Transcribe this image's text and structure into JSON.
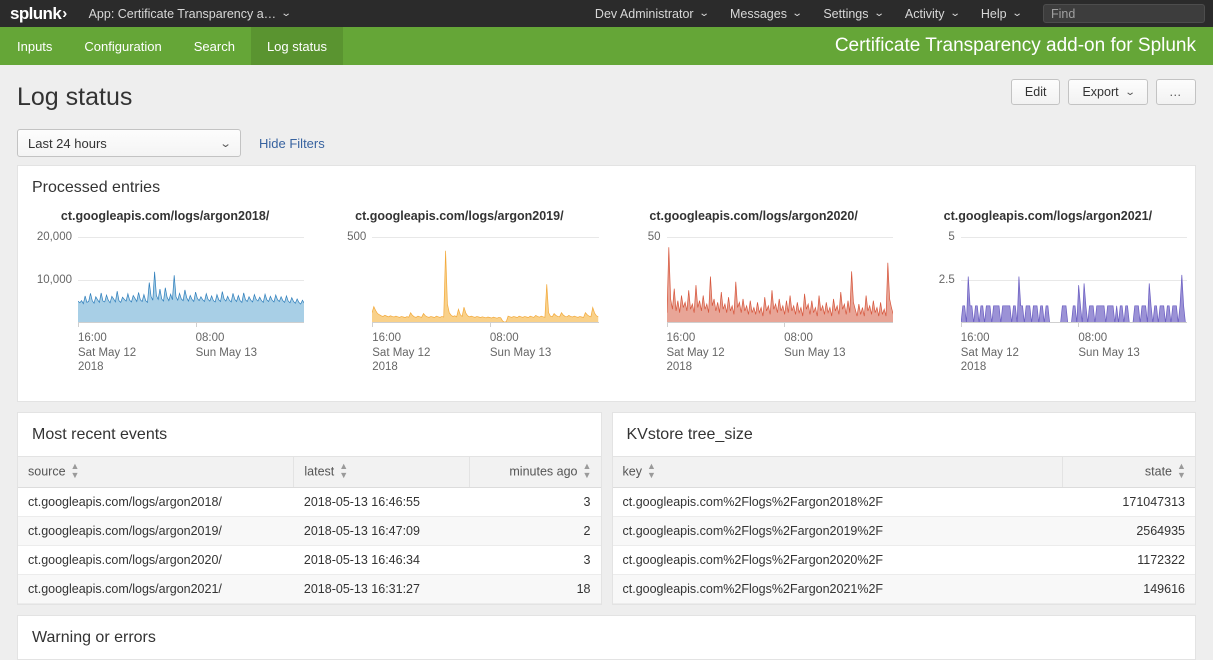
{
  "topbar": {
    "logo": "splunk",
    "logo_chevron": "›",
    "app_menu": "App: Certificate Transparency a…",
    "nav": [
      {
        "label": "Dev Administrator",
        "caret": "⌄"
      },
      {
        "label": "Messages",
        "caret": "⌄"
      },
      {
        "label": "Settings",
        "caret": "⌄"
      },
      {
        "label": "Activity",
        "caret": "⌄"
      },
      {
        "label": "Help",
        "caret": "⌄"
      }
    ],
    "find_placeholder": "Find",
    "find_value": ""
  },
  "appbar": {
    "items": [
      {
        "label": "Inputs",
        "active": false
      },
      {
        "label": "Configuration",
        "active": false
      },
      {
        "label": "Search",
        "active": false
      },
      {
        "label": "Log status",
        "active": true
      }
    ],
    "title": "Certificate Transparency add-on for Splunk"
  },
  "page": {
    "title": "Log status",
    "actions": {
      "edit": "Edit",
      "export": "Export",
      "export_caret": "⌄",
      "more": "…"
    }
  },
  "filters": {
    "time_range": "Last 24 hours",
    "time_caret": "⌄",
    "hide_filters": "Hide Filters"
  },
  "panels": {
    "processed_entries": "Processed entries",
    "most_recent_events": "Most recent events",
    "kvstore_tree_size": "KVstore tree_size",
    "warning_or_errors": "Warning or errors"
  },
  "chart_data": [
    {
      "type": "area",
      "title": "ct.googleapis.com/logs/argon2018/",
      "color": "#2e7ebb",
      "fill": "#a8cfe6",
      "ylim": [
        0,
        20000
      ],
      "yticks": [
        20000,
        10000
      ],
      "ytick_labels": [
        "20,000",
        "10,000"
      ],
      "xlabels": [
        {
          "time": "16:00",
          "date": "Sat May 12",
          "year": "2018",
          "pos": 0.0
        },
        {
          "time": "08:00",
          "date": "Sun May 13",
          "year": "",
          "pos": 0.52
        }
      ],
      "values": [
        5100,
        4700,
        5200,
        4500,
        6300,
        4800,
        5000,
        6900,
        5200,
        4600,
        6100,
        5400,
        4800,
        7000,
        5100,
        4900,
        6500,
        5300,
        4700,
        6200,
        5600,
        4900,
        7400,
        5200,
        4800,
        6000,
        5500,
        5100,
        6800,
        5300,
        4900,
        6400,
        5700,
        5000,
        7100,
        5400,
        5000,
        6600,
        5200,
        4800,
        9400,
        6200,
        5300,
        11900,
        6400,
        5500,
        7900,
        5600,
        5100,
        8200,
        6000,
        5200,
        6700,
        5400,
        11100,
        6100,
        5300,
        6900,
        5600,
        5200,
        7700,
        5900,
        5100,
        6400,
        5500,
        5000,
        7200,
        5700,
        5200,
        6100,
        5400,
        5000,
        6800,
        5500,
        5100,
        6300,
        5200,
        4900,
        6600,
        5400,
        5000,
        7300,
        5600,
        5100,
        6200,
        5300,
        4900,
        6900,
        5500,
        5000,
        6400,
        5200,
        4800,
        7000,
        5400,
        5000,
        6100,
        5300,
        4900,
        6600,
        5500,
        5100,
        6000,
        5200,
        4800,
        6700,
        5400,
        5000,
        6200,
        5300,
        4900,
        6500,
        5400,
        5000,
        6100,
        5200,
        4800,
        6300,
        5100,
        4700,
        5900,
        5000,
        4600,
        5600,
        4800,
        4400,
        5300,
        4600
      ]
    },
    {
      "type": "area",
      "title": "ct.googleapis.com/logs/argon2019/",
      "color": "#f2a93b",
      "fill": "#f9d18a",
      "ylim": [
        0,
        500
      ],
      "yticks": [
        500
      ],
      "ytick_labels": [
        "500"
      ],
      "xlabels": [
        {
          "time": "16:00",
          "date": "Sat May 12",
          "year": "2018",
          "pos": 0.0
        },
        {
          "time": "08:00",
          "date": "Sun May 13",
          "year": "",
          "pos": 0.52
        }
      ],
      "values": [
        60,
        95,
        72,
        55,
        48,
        42,
        38,
        45,
        40,
        36,
        42,
        38,
        35,
        40,
        36,
        33,
        38,
        35,
        32,
        37,
        34,
        60,
        44,
        36,
        33,
        40,
        36,
        33,
        55,
        42,
        36,
        33,
        38,
        35,
        32,
        40,
        36,
        33,
        38,
        35,
        420,
        110,
        60,
        45,
        38,
        42,
        36,
        80,
        48,
        38,
        92,
        58,
        42,
        36,
        40,
        36,
        33,
        38,
        35,
        32,
        36,
        33,
        30,
        35,
        32,
        29,
        34,
        31,
        28,
        33,
        30,
        12,
        5,
        8,
        40,
        36,
        33,
        38,
        35,
        32,
        40,
        36,
        33,
        38,
        35,
        32,
        40,
        36,
        33,
        44,
        38,
        34,
        40,
        36,
        33,
        225,
        60,
        40,
        36,
        55,
        44,
        38,
        36,
        60,
        46,
        38,
        36,
        44,
        38,
        35,
        40,
        36,
        33,
        38,
        35,
        32,
        60,
        48,
        40,
        36,
        90,
        58,
        42,
        36
      ]
    },
    {
      "type": "area",
      "title": "ct.googleapis.com/logs/argon2020/",
      "color": "#d6563c",
      "fill": "#e8a597",
      "ylim": [
        0,
        50
      ],
      "yticks": [
        50
      ],
      "ytick_labels": [
        "50"
      ],
      "xlabels": [
        {
          "time": "16:00",
          "date": "Sat May 12",
          "year": "2018",
          "pos": 0.0
        },
        {
          "time": "08:00",
          "date": "Sun May 13",
          "year": "",
          "pos": 0.52
        }
      ],
      "values": [
        6,
        44,
        14,
        8,
        20,
        7,
        13,
        6,
        16,
        9,
        12,
        7,
        19,
        8,
        11,
        6,
        22,
        9,
        13,
        7,
        16,
        8,
        11,
        6,
        27,
        10,
        14,
        7,
        12,
        6,
        18,
        8,
        11,
        6,
        15,
        7,
        10,
        5,
        24,
        9,
        12,
        6,
        14,
        7,
        10,
        5,
        13,
        6,
        9,
        5,
        12,
        6,
        9,
        4,
        15,
        7,
        10,
        5,
        19,
        8,
        11,
        6,
        14,
        7,
        10,
        5,
        13,
        6,
        16,
        7,
        10,
        5,
        12,
        6,
        9,
        4,
        17,
        8,
        11,
        5,
        13,
        6,
        9,
        4,
        16,
        7,
        10,
        5,
        12,
        6,
        9,
        4,
        14,
        7,
        10,
        5,
        18,
        8,
        11,
        5,
        13,
        6,
        30,
        12,
        8,
        4,
        11,
        5,
        9,
        4,
        16,
        7,
        10,
        5,
        13,
        6,
        9,
        4,
        12,
        5,
        8,
        4,
        35,
        14,
        9,
        5
      ]
    },
    {
      "type": "area",
      "title": "ct.googleapis.com/logs/argon2021/",
      "color": "#6a5dc1",
      "fill": "#9b92d6",
      "ylim": [
        0,
        5
      ],
      "yticks": [
        5,
        2.5
      ],
      "ytick_labels": [
        "5",
        "2.5"
      ],
      "xlabels": [
        {
          "time": "16:00",
          "date": "Sat May 12",
          "year": "2018",
          "pos": 0.0
        },
        {
          "time": "08:00",
          "date": "Sun May 13",
          "year": "",
          "pos": 0.52
        }
      ],
      "values": [
        0,
        1,
        1,
        0,
        2.7,
        1,
        1,
        0,
        1,
        1,
        0,
        1,
        1,
        0,
        1,
        1,
        1,
        0,
        1,
        1,
        1,
        1,
        0,
        1,
        1,
        1,
        1,
        1,
        0,
        1,
        1,
        0,
        2.7,
        1,
        1,
        0,
        1,
        1,
        1,
        0,
        1,
        1,
        1,
        0,
        1,
        1,
        0,
        1,
        1,
        0,
        0,
        0,
        0,
        0,
        0,
        0,
        1,
        1,
        1,
        0,
        0,
        0,
        1,
        1,
        0,
        2.2,
        1,
        0,
        2.3,
        1,
        0,
        1,
        1,
        1,
        0,
        1,
        1,
        1,
        1,
        1,
        0,
        1,
        1,
        1,
        1,
        0,
        1,
        0,
        1,
        1,
        0,
        1,
        1,
        0,
        0,
        0,
        1,
        1,
        1,
        0,
        1,
        1,
        1,
        0,
        2.3,
        1,
        0,
        1,
        1,
        0,
        1,
        1,
        1,
        0,
        1,
        1,
        0,
        1,
        1,
        1,
        0,
        1,
        2.8,
        1,
        0,
        0
      ]
    }
  ],
  "most_recent_events": {
    "columns": [
      "source",
      "latest",
      "minutes ago"
    ],
    "rows": [
      [
        "ct.googleapis.com/logs/argon2018/",
        "2018-05-13 16:46:55",
        "3"
      ],
      [
        "ct.googleapis.com/logs/argon2019/",
        "2018-05-13 16:47:09",
        "2"
      ],
      [
        "ct.googleapis.com/logs/argon2020/",
        "2018-05-13 16:46:34",
        "3"
      ],
      [
        "ct.googleapis.com/logs/argon2021/",
        "2018-05-13 16:31:27",
        "18"
      ]
    ]
  },
  "kvstore_tree_size": {
    "columns": [
      "key",
      "state"
    ],
    "rows": [
      [
        "ct.googleapis.com%2Flogs%2Fargon2018%2F",
        "171047313"
      ],
      [
        "ct.googleapis.com%2Flogs%2Fargon2019%2F",
        "2564935"
      ],
      [
        "ct.googleapis.com%2Flogs%2Fargon2020%2F",
        "1172322"
      ],
      [
        "ct.googleapis.com%2Flogs%2Fargon2021%2F",
        "149616"
      ]
    ]
  },
  "colors": {
    "brand_green": "#65a637",
    "brand_green_active": "#5a9430",
    "topbar_dark": "#2b2b2b",
    "link_blue": "#3863a0"
  }
}
